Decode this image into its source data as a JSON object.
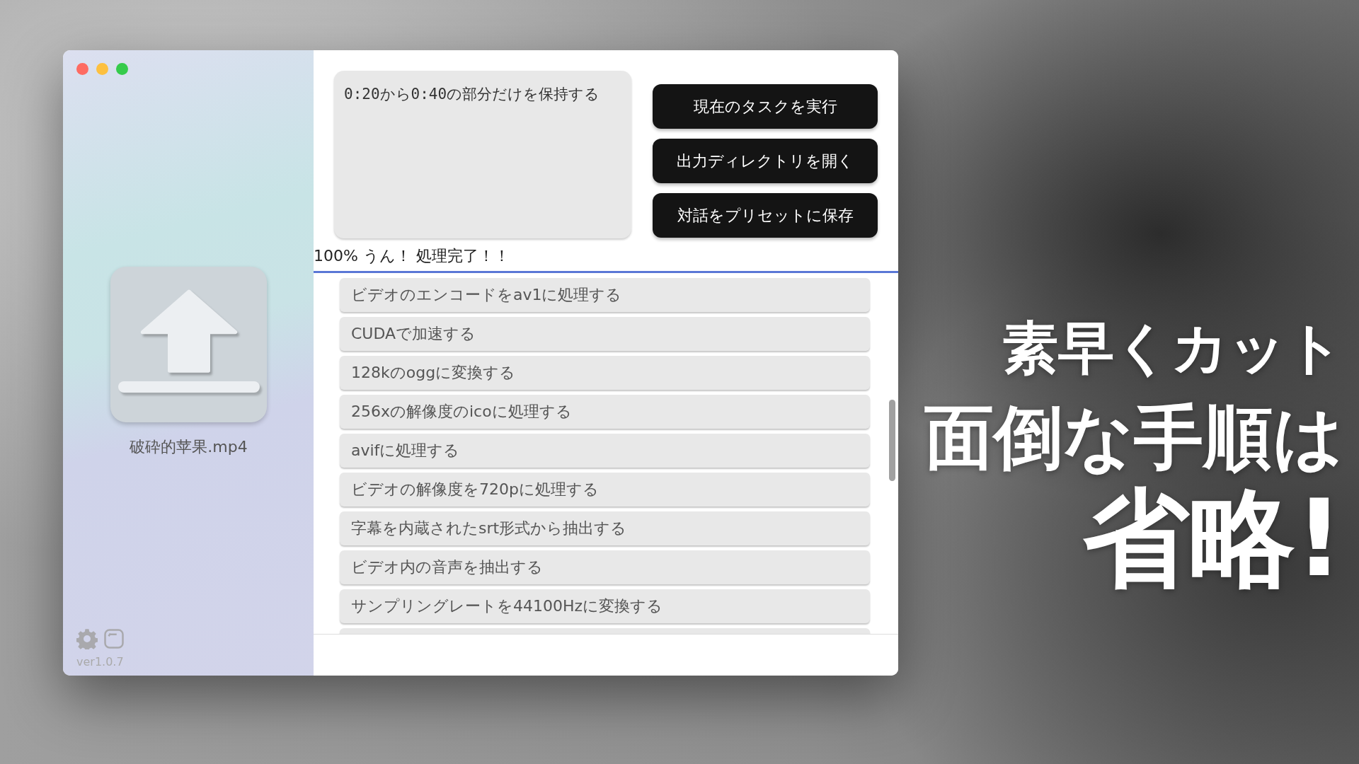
{
  "sidebar": {
    "file_name": "破砕的苹果.mp4",
    "version": "ver1.0.7"
  },
  "prompt": {
    "value": "0:20から0:40の部分だけを保持する"
  },
  "buttons": [
    "現在のタスクを実行",
    "出力ディレクトリを開く",
    "対話をプリセットに保存"
  ],
  "status": {
    "text": "100% うん！ 処理完了！！",
    "level": 1
  },
  "presets": [
    "ビデオのエンコードをav1に処理する",
    "CUDAで加速する",
    "128kのoggに変換する",
    "256xの解像度のicoに処理する",
    "avifに処理する",
    "ビデオの解像度を720pに処理する",
    "字幕を内蔵されたsrt形式から抽出する",
    "ビデオ内の音声を抽出する",
    "サンプリングレートを44100Hzに変換する"
  ],
  "headline": [
    "素早くカット",
    "面倒な手順は",
    "省略!"
  ]
}
